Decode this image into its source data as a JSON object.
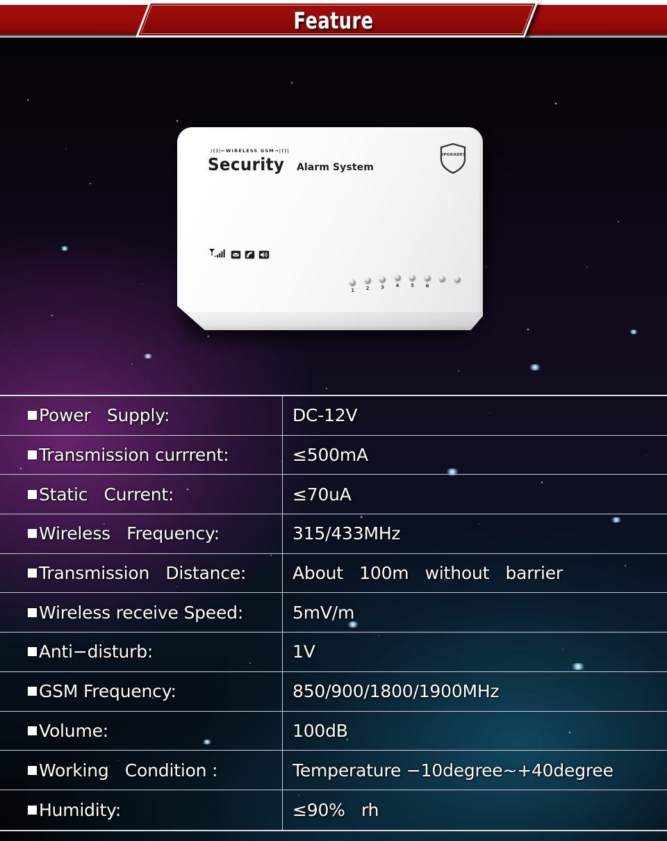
{
  "banner": {
    "title": "Feature"
  },
  "device": {
    "tagline": "|()|←WIRELESS GSM→|()|",
    "brand_main": "Security",
    "brand_sub": "Alarm System",
    "badge_text": "UPGRADES",
    "status_icons": [
      "signal-bars-icon",
      "envelope-icon",
      "phone-icon",
      "speaker-icon"
    ],
    "led_labels": [
      "1",
      "2",
      "3",
      "4",
      "5",
      "6",
      "",
      ""
    ]
  },
  "spec_table": {
    "rows": [
      {
        "label": "Power   Supply:",
        "value": "DC-12V"
      },
      {
        "label": "Transmission currrent:",
        "value": "≤500mA"
      },
      {
        "label": "Static   Current:",
        "value": "≤70uA"
      },
      {
        "label": "Wireless   Frequency:",
        "value": "315/433MHz"
      },
      {
        "label": "Transmission   Distance:",
        "value": "About   100m   without   barrier"
      },
      {
        "label": "Wireless receive Speed:",
        "value": "5mV/m"
      },
      {
        "label": "Anti−disturb:",
        "value": "1V"
      },
      {
        "label": "GSM Frequency:",
        "value": "850/900/1800/1900MHz"
      },
      {
        "label": "Volume:",
        "value": "100dB"
      },
      {
        "label": "Working   Condition :",
        "value": "Temperature −10degree~+40degree"
      },
      {
        "label": "Humidity:",
        "value": "≤90%   rh"
      }
    ]
  },
  "colors": {
    "banner_red": "#9e0c0b",
    "banner_white": "#ffffff",
    "table_border": "#c9ced8",
    "text": "#ffffff",
    "nebula_purple": "#76267a",
    "nebula_blue": "#145470"
  }
}
